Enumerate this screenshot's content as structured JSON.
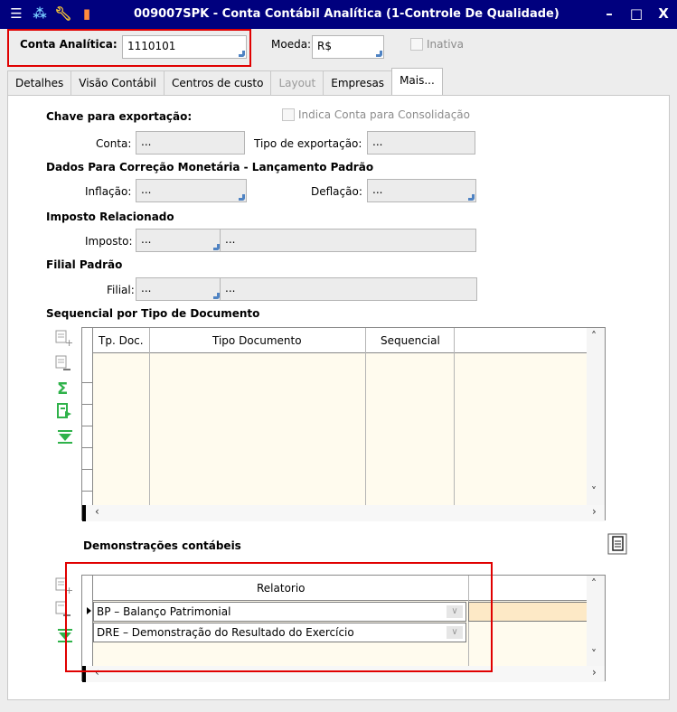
{
  "title": {
    "text": "009007SPK - Conta Contábil Analítica (1-Controle De Qualidade)",
    "minimize": "–",
    "maximize": "□",
    "close": "X"
  },
  "header": {
    "conta_label": "Conta Analítica:",
    "conta_value": "1110101",
    "moeda_label": "Moeda:",
    "moeda_value": "R$",
    "inativa_label": "Inativa"
  },
  "tabs": [
    {
      "label": "Detalhes"
    },
    {
      "label": "Visão Contábil"
    },
    {
      "label": "Centros de custo"
    },
    {
      "label": "Layout",
      "disabled": true
    },
    {
      "label": "Empresas"
    },
    {
      "label": "Mais...",
      "active": true
    }
  ],
  "export": {
    "section_title": "Chave para exportação:",
    "consolidacao_label": "Indica Conta para Consolidação",
    "conta_label": "Conta:",
    "conta_value": "...",
    "tipo_label": "Tipo de exportação:",
    "tipo_value": "..."
  },
  "correcao": {
    "section_title": "Dados Para Correção Monetária - Lançamento Padrão",
    "inflacao_label": "Inflação:",
    "inflacao_value": "...",
    "deflacao_label": "Deflação:",
    "deflacao_value": "..."
  },
  "imposto": {
    "section_title": "Imposto Relacionado",
    "label": "Imposto:",
    "code": "...",
    "desc": "..."
  },
  "filial": {
    "section_title": "Filial Padrão",
    "label": "Filial:",
    "code": "...",
    "desc": "..."
  },
  "sequencial": {
    "section_title": "Sequencial por Tipo de Documento",
    "columns": [
      "Tp. Doc.",
      "Tipo Documento",
      "Sequencial"
    ]
  },
  "demonstracoes": {
    "section_title": "Demonstrações contábeis",
    "column": "Relatorio",
    "rows": [
      "BP – Balanço Patrimonial",
      "DRE – Demonstração do Resultado do Exercício"
    ]
  },
  "icons": {
    "add_row": "add-row-icon",
    "remove_row": "remove-row-icon",
    "sum": "sum-icon",
    "export": "export-icon",
    "filter": "filter-icon",
    "document": "document-icon"
  },
  "colors": {
    "title_bar": "#00007e",
    "highlight": "#e00000",
    "grid_bg": "#fffbee",
    "selected_cell": "#fde9c6",
    "green": "#2fb24a"
  }
}
